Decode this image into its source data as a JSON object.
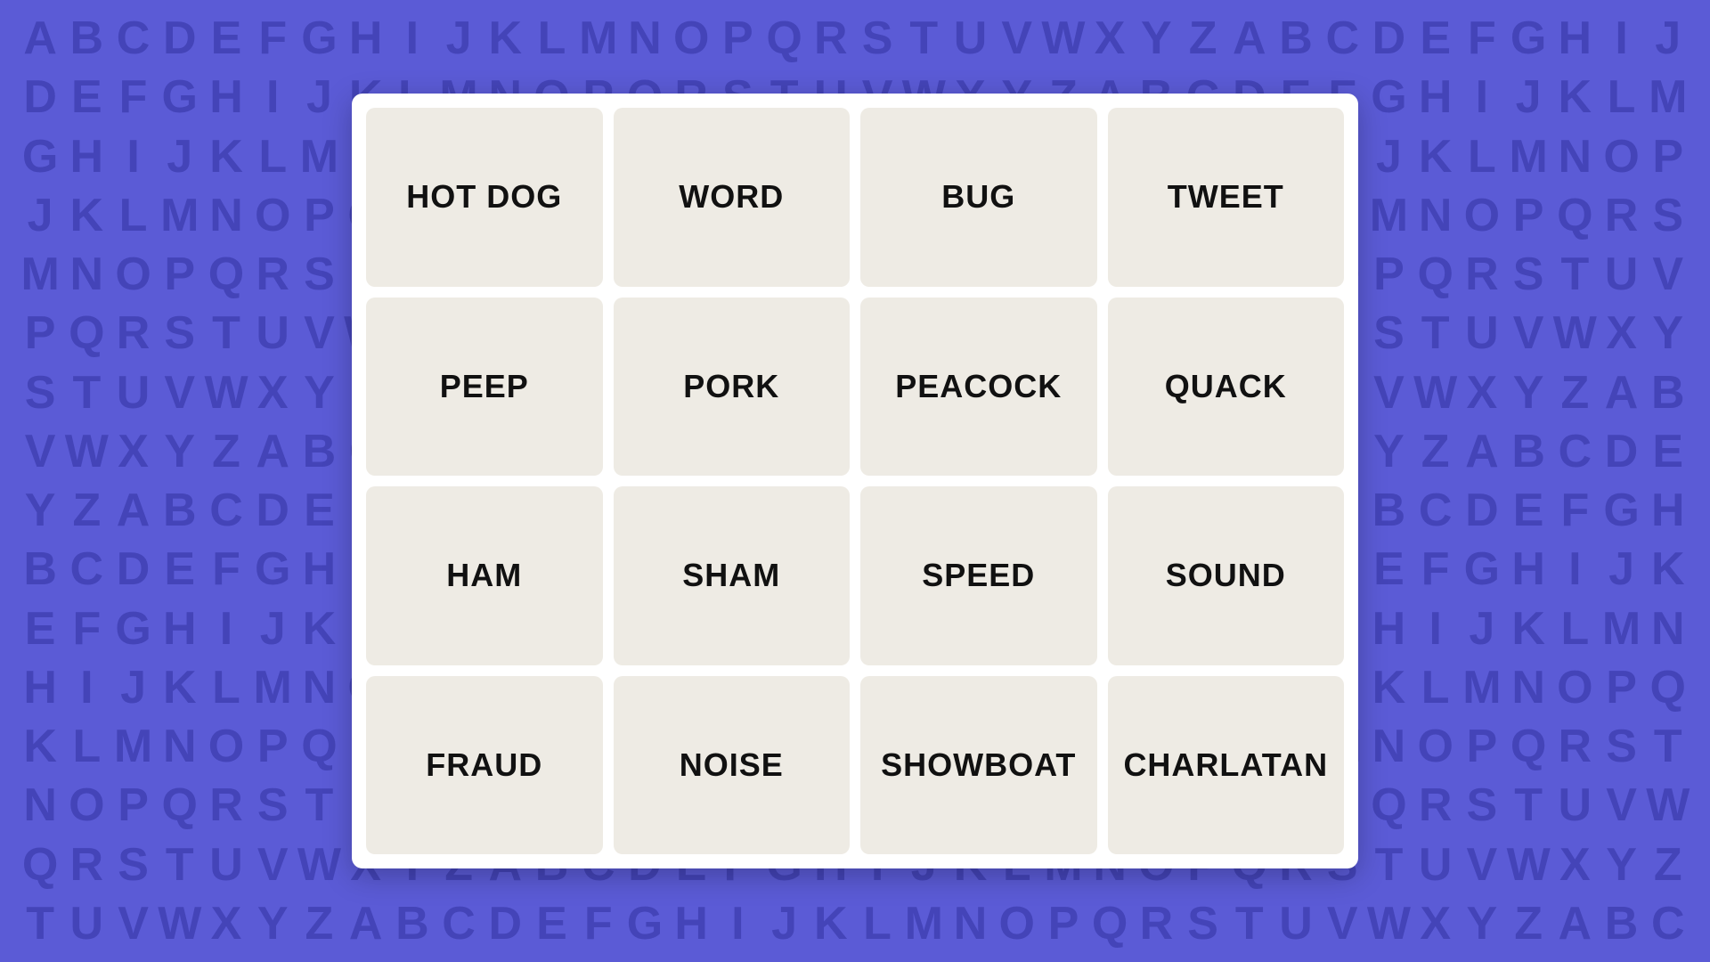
{
  "background": {
    "color": "#5b5bd6",
    "alphabet_chars": "ABCDEFGHIJKLMNOPQRSTUVWXYZ"
  },
  "panel": {
    "background": "#ffffff"
  },
  "grid": {
    "rows": 4,
    "cols": 4,
    "words": [
      {
        "id": "hot-dog",
        "label": "HOT DOG"
      },
      {
        "id": "word",
        "label": "WORD"
      },
      {
        "id": "bug",
        "label": "BUG"
      },
      {
        "id": "tweet",
        "label": "TWEET"
      },
      {
        "id": "peep",
        "label": "PEEP"
      },
      {
        "id": "pork",
        "label": "PORK"
      },
      {
        "id": "peacock",
        "label": "PEACOCK"
      },
      {
        "id": "quack",
        "label": "QUACK"
      },
      {
        "id": "ham",
        "label": "HAM"
      },
      {
        "id": "sham",
        "label": "SHAM"
      },
      {
        "id": "speed",
        "label": "SPEED"
      },
      {
        "id": "sound",
        "label": "SOUND"
      },
      {
        "id": "fraud",
        "label": "FRAUD"
      },
      {
        "id": "noise",
        "label": "NOISE"
      },
      {
        "id": "showboat",
        "label": "SHOWBOAT"
      },
      {
        "id": "charlatan",
        "label": "CHARLATAN"
      }
    ]
  }
}
